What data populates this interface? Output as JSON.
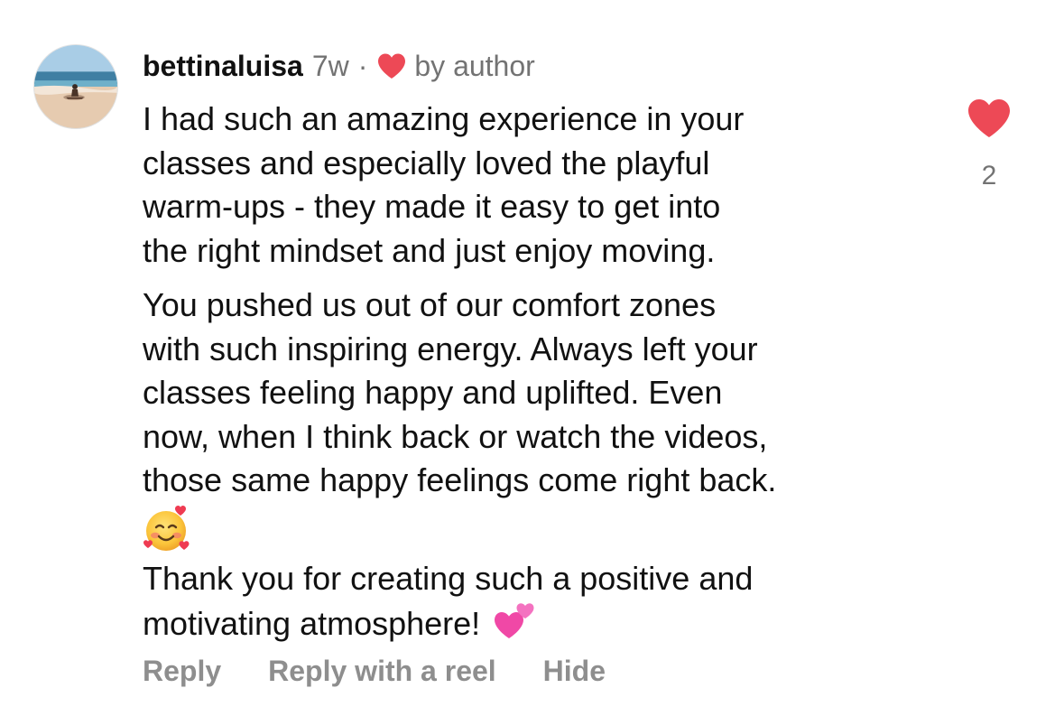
{
  "comment": {
    "username": "bettinaluisa",
    "time": "7w",
    "separator": "·",
    "author_badge_icon": "heart-icon",
    "author_badge_text": "by author",
    "paragraph1": "I had such an amazing experience in your\nclasses and especially loved the playful\nwarm-ups - they made it easy to get into\nthe right mindset and just enjoy moving.",
    "paragraph2": "You pushed us out of our comfort zones\nwith such inspiring energy. Always left your\nclasses feeling happy and uplifted. Even\nnow, when I think back or watch the videos,\nthose same happy feelings come right back.",
    "emoji_face": "smiling-face-with-hearts-emoji",
    "paragraph3": "Thank you for creating such a positive and\nmotivating atmosphere!",
    "paragraph3_emoji": "two-hearts-emoji",
    "like_icon": "heart-filled-icon",
    "like_count": "2",
    "accent_color": "#ed4956",
    "muted_color": "#737373"
  },
  "actions": {
    "reply": "Reply",
    "reply_with_reel": "Reply with a reel",
    "hide": "Hide"
  }
}
